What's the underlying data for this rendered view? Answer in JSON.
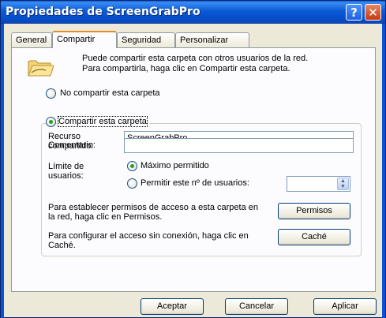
{
  "window": {
    "title": "Propiedades de ScreenGrabPro",
    "help_glyph": "?",
    "close_glyph": "✕"
  },
  "tabs": [
    {
      "label": "General"
    },
    {
      "label": "Compartir"
    },
    {
      "label": "Seguridad"
    },
    {
      "label": "Personalizar"
    }
  ],
  "active_tab": "Compartir",
  "intro": {
    "icon": "shared-folder-icon",
    "line1": "Puede compartir esta carpeta con otros usuarios de la red.",
    "line2": "Para compartirla, haga clic en Compartir esta carpeta."
  },
  "share_options": {
    "no_share_label": "No compartir esta carpeta",
    "share_label": "Compartir esta carpeta",
    "selected": "share"
  },
  "share_group": {
    "resource_label": "Recurso compartido:",
    "resource_value": "ScreenGrabPro",
    "comment_label": "Comentario:",
    "comment_value": "",
    "user_limit_label": "Límite de usuarios:",
    "max_allowed_label": "Máximo permitido",
    "allow_users_label": "Permitir este nº de usuarios:",
    "user_limit_selected": "max",
    "user_count_value": "",
    "permissions_text": "Para establecer permisos de acceso a esta carpeta en la red, haga clic en Permisos.",
    "permissions_button": "Permisos",
    "offline_text": "Para configurar el acceso sin conexión, haga clic en Caché.",
    "cache_button": "Caché"
  },
  "footer": {
    "accept_button": "Aceptar",
    "cancel_button": "Cancelar",
    "apply_button": "Aplicar"
  },
  "colors": {
    "titlebar": "#0a5fd9",
    "dialog_bg": "#ece9d8",
    "active_tab_accent": "#e68b2c",
    "radio_dot": "#21a121"
  }
}
